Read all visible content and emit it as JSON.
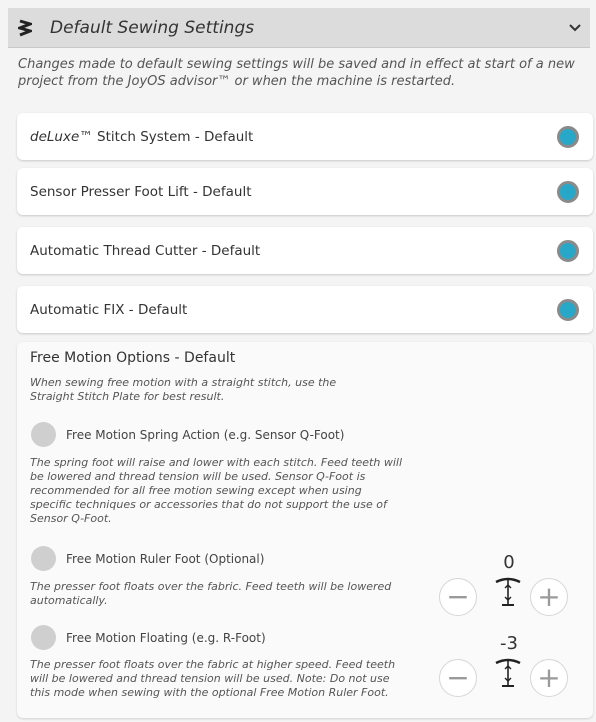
{
  "header": {
    "title": "Default Sewing Settings",
    "logo_icon": "sewing-zigzag-icon",
    "chevron_icon": "chevron-down-icon"
  },
  "intro": "Changes made to default sewing settings will be saved and in effect at start of a new project from the JoyOS advisor™ or when the machine is restarted.",
  "settings": [
    {
      "label_italic": "deLuxe",
      "label": "™ Stitch System - Default",
      "selected": true
    },
    {
      "label_italic": "",
      "label": "Sensor Presser Foot Lift - Default",
      "selected": true
    },
    {
      "label_italic": "",
      "label": "Automatic Thread Cutter - Default",
      "selected": true
    },
    {
      "label_italic": "",
      "label": "Automatic FIX - Default",
      "selected": true
    }
  ],
  "free_motion": {
    "title": "Free Motion Options - Default",
    "note": "When sewing free motion with a straight stitch, use the Straight Stitch Plate for best result.",
    "options": [
      {
        "label": "Free Motion Spring Action (e.g. Sensor Q-Foot)",
        "description": "The spring foot will raise and lower with each stitch. Feed teeth will be lowered and thread tension will be used. Sensor Q-Foot is recommended for all free motion sewing except when using specific techniques or accessories that do not support the use of Sensor Q-Foot.",
        "selected": false
      },
      {
        "label": "Free Motion Ruler Foot (Optional)",
        "description": "The presser foot floats over the fabric. Feed teeth will be lowered automatically.",
        "selected": false,
        "height_value": "0"
      },
      {
        "label": "Free Motion Floating (e.g. R-Foot)",
        "description": "The presser foot floats over the fabric at higher speed. Feed teeth will be lowered and thread tension will be used. Note: Do not use this mode when sewing with the optional Free Motion Ruler Foot.",
        "selected": false,
        "height_value": "-3"
      }
    ],
    "minus_label": "−",
    "plus_label": "+"
  },
  "colors": {
    "accent": "#27a8c9",
    "header_bg": "#dcdcdc"
  }
}
